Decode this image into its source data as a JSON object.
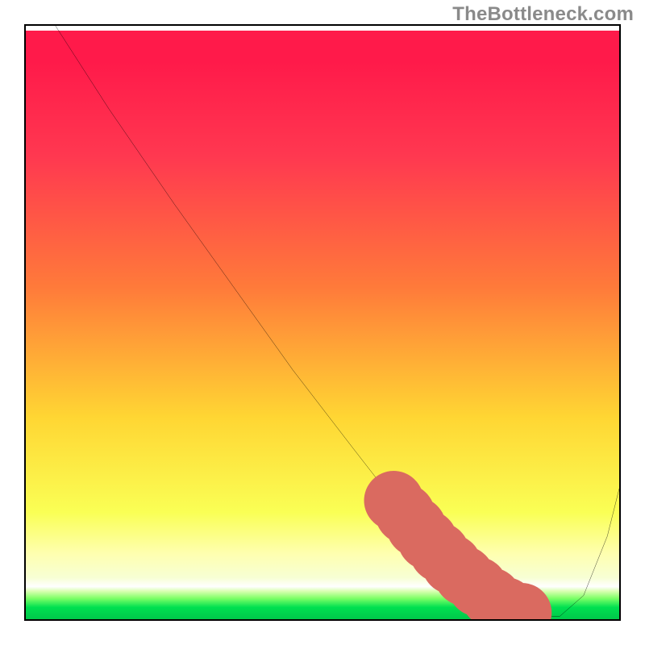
{
  "watermark": "TheBottleneck.com",
  "chart_data": {
    "type": "line",
    "title": "",
    "xlabel": "",
    "ylabel": "",
    "xlim": [
      0,
      100
    ],
    "ylim": [
      0,
      100
    ],
    "grid": false,
    "series": [
      {
        "name": "bottleneck-curve",
        "color": "#000000",
        "x": [
          5,
          14,
          25,
          35,
          45,
          55,
          62,
          68,
          73,
          78,
          82,
          86,
          90,
          94,
          98,
          100
        ],
        "values": [
          100,
          86,
          70,
          56,
          42,
          29,
          20,
          13,
          8,
          4,
          1.5,
          0.5,
          0.5,
          4,
          14,
          22
        ]
      }
    ],
    "highlight": {
      "name": "bottleneck-zone",
      "color": "#da6a60",
      "style": "thick-dash",
      "x": [
        62,
        68,
        73,
        78,
        80,
        82,
        84,
        86
      ],
      "values": [
        20,
        13,
        8,
        4,
        2.5,
        1.5,
        1,
        0.5
      ]
    }
  }
}
